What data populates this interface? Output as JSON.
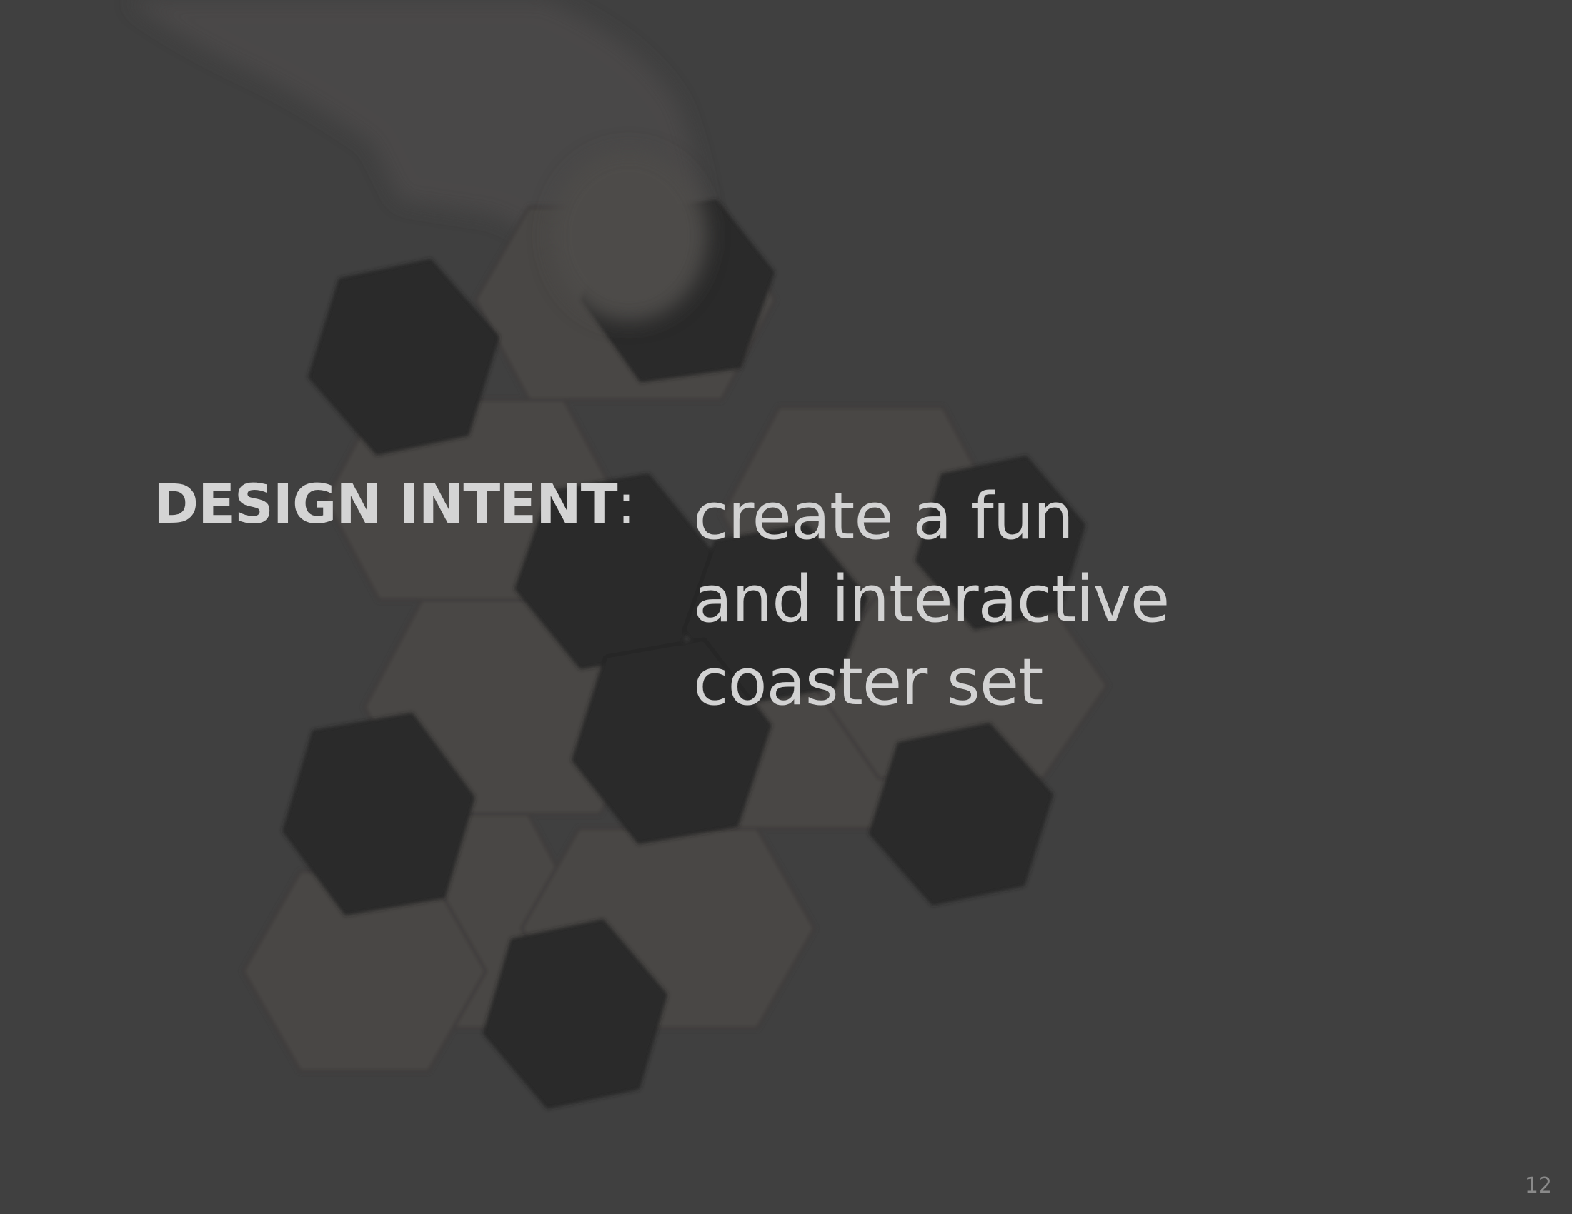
{
  "slide": {
    "heading": "DESIGN INTENT",
    "heading_colon": ":",
    "intent_lines": [
      "create a fun",
      "and interactive",
      "coaster set"
    ],
    "page_number": "12"
  },
  "colors": {
    "background": "#404040",
    "heading_text": "#d4d4d4",
    "body_text": "#d2d2d2",
    "page_number": "#8a8a8a",
    "coaster_dark": "#2b2b2b",
    "coaster_wood": "#4a4746"
  }
}
